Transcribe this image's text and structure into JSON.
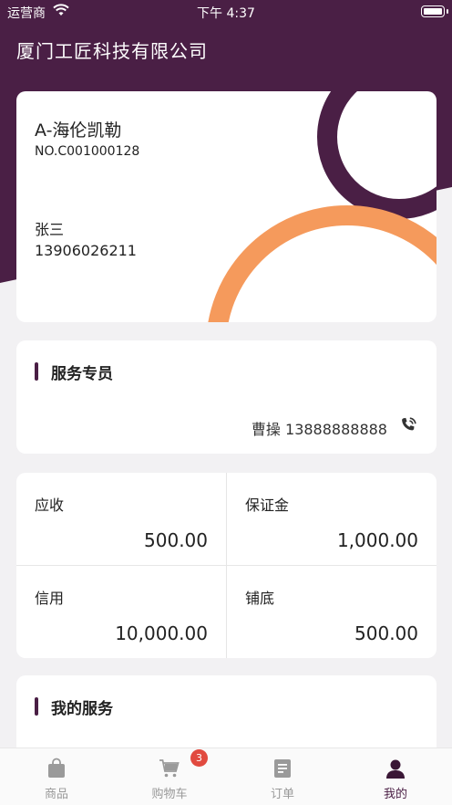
{
  "status_bar": {
    "carrier": "运营商",
    "time": "下午 4:37"
  },
  "header": {
    "company": "厦门工匠科技有限公司"
  },
  "member": {
    "name": "A-海伦凯勒",
    "number": "NO.C001000128",
    "person": "张三",
    "phone": "13906026211"
  },
  "service": {
    "title": "服务专员",
    "contact": "曹操 13888888888"
  },
  "finance": {
    "receivable_label": "应收",
    "receivable_value": "500.00",
    "deposit_label": "保证金",
    "deposit_value": "1,000.00",
    "credit_label": "信用",
    "credit_value": "10,000.00",
    "base_label": "铺底",
    "base_value": "500.00"
  },
  "my_service": {
    "title": "我的服务"
  },
  "tabs": [
    {
      "label": "商品",
      "icon": "bag-icon"
    },
    {
      "label": "购物车",
      "icon": "cart-icon",
      "badge": "3"
    },
    {
      "label": "订单",
      "icon": "order-icon"
    },
    {
      "label": "我的",
      "icon": "user-icon",
      "active": true
    }
  ],
  "colors": {
    "primary": "#4a1f45",
    "accent": "#f59a5c",
    "badge": "#e14a3f"
  }
}
